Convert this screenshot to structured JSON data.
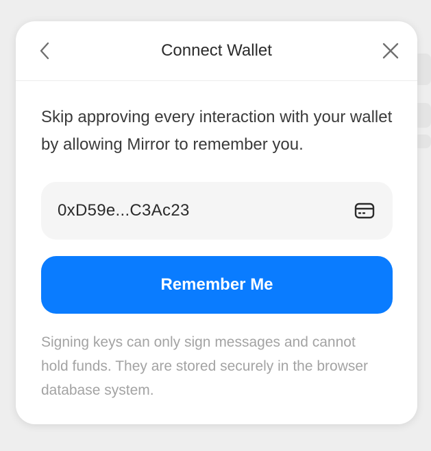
{
  "modal": {
    "title": "Connect Wallet",
    "description": "Skip approving every interaction with your wallet by allowing Mirror to remember you.",
    "address": "0xD59e...C3Ac23",
    "button_label": "Remember Me",
    "footnote": "Signing keys can only sign messages and cannot hold funds. They are stored securely in the browser database system."
  },
  "icons": {
    "back": "chevron-left-icon",
    "close": "close-icon",
    "wallet": "wallet-icon"
  },
  "colors": {
    "accent": "#0a7cff",
    "text": "#2b2b2b",
    "muted": "#a3a3a3",
    "input_bg": "#f5f5f5"
  }
}
